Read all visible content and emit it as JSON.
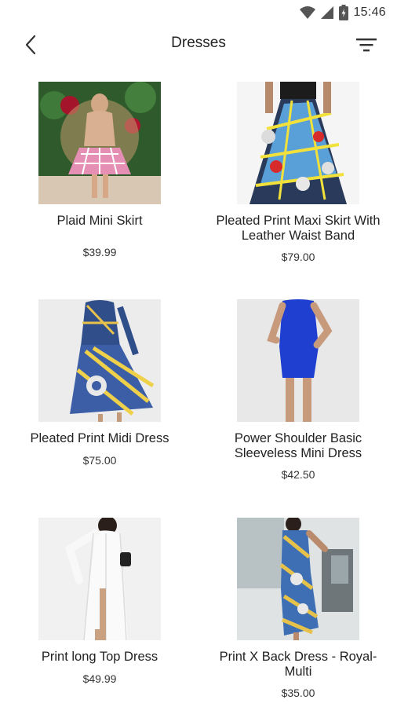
{
  "status": {
    "time": "15:46",
    "icons": [
      "wifi-icon",
      "cell-signal-icon",
      "battery-charging-icon"
    ]
  },
  "app_bar": {
    "back_icon": "chevron-left-icon",
    "title": "Dresses",
    "filter_icon": "sort-filter-icon"
  },
  "products": [
    {
      "name": "Plaid Mini Skirt",
      "price": "$39.99",
      "image": "pink plaid mini skirt"
    },
    {
      "name": "Pleated Print Maxi Skirt With Leather Waist Band",
      "price": "$79.00",
      "image": "blue print maxi skirt"
    },
    {
      "name": "Pleated Print Midi Dress",
      "price": "$75.00",
      "image": "blue yellow print midi dress"
    },
    {
      "name": "Power Shoulder Basic Sleeveless Mini Dress",
      "price": "$42.50",
      "image": "royal blue mini dress"
    },
    {
      "name": "Print long Top Dress",
      "price": "$49.99",
      "image": "white long top dress"
    },
    {
      "name": "Print X Back Dress - Royal-Multi",
      "price": "$35.00",
      "image": "blue print bodycon dress"
    }
  ]
}
